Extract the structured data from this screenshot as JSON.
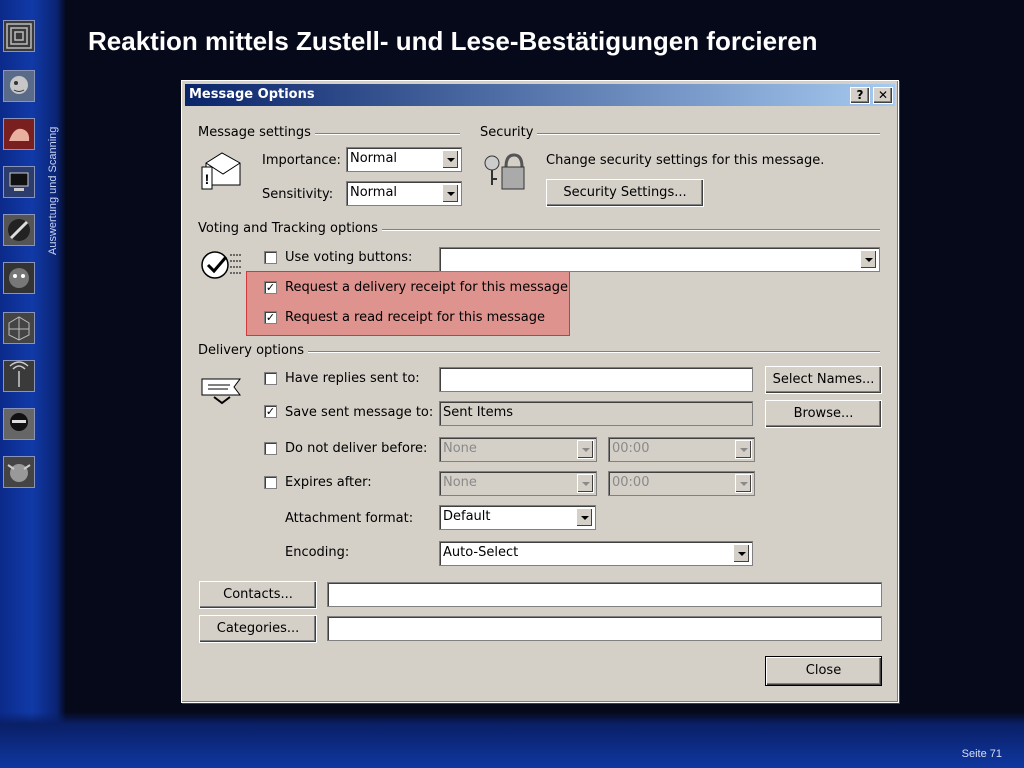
{
  "slide": {
    "title": "Reaktion mittels Zustell- und Lese-Bestätigungen forcieren",
    "sidebar_text": "Auswertung und Scanning",
    "page_number": "Seite 71"
  },
  "dialog": {
    "title": "Message Options",
    "help_button": "?",
    "close_x": "✕",
    "message_settings": {
      "group_label": "Message settings",
      "importance_label": "Importance:",
      "importance_value": "Normal",
      "sensitivity_label": "Sensitivity:",
      "sensitivity_value": "Normal"
    },
    "security": {
      "group_label": "Security",
      "text": "Change security settings for this message.",
      "button": "Security Settings..."
    },
    "voting": {
      "group_label": "Voting and Tracking options",
      "use_voting_label": "Use voting buttons:",
      "use_voting_checked": false,
      "delivery_receipt_label": "Request a delivery receipt for this message",
      "delivery_receipt_checked": true,
      "read_receipt_label": "Request a read receipt for this message",
      "read_receipt_checked": true
    },
    "delivery": {
      "group_label": "Delivery options",
      "replies_label": "Have replies sent to:",
      "replies_value": "",
      "select_names_button": "Select Names...",
      "save_sent_label": "Save sent message to:",
      "save_sent_value": "Sent Items",
      "save_sent_checked": true,
      "browse_button": "Browse...",
      "not_before_label": "Do not deliver before:",
      "not_before_date": "None",
      "not_before_time": "00:00",
      "expires_label": "Expires after:",
      "expires_date": "None",
      "expires_time": "00:00",
      "attachment_label": "Attachment format:",
      "attachment_value": "Default",
      "encoding_label": "Encoding:",
      "encoding_value": "Auto-Select"
    },
    "contacts_button": "Contacts...",
    "categories_button": "Categories...",
    "close_button": "Close",
    "check_mark": "✓"
  }
}
